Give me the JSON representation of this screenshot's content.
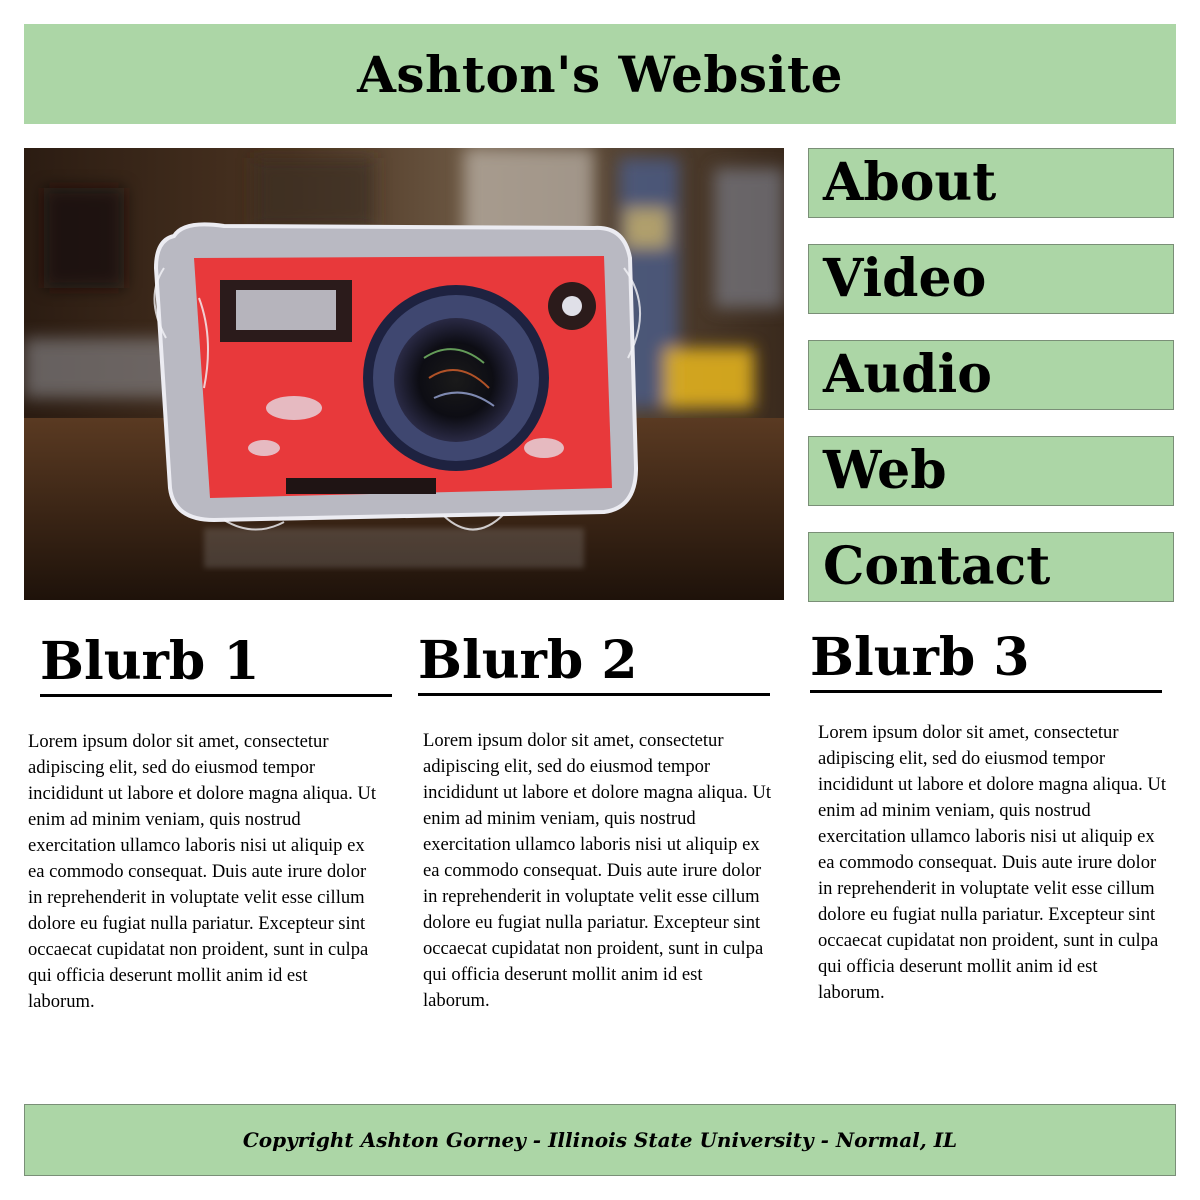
{
  "header": {
    "title": "Ashton's Website"
  },
  "hero": {
    "image_subject": "handmade-red-camera-sculpture"
  },
  "nav": {
    "items": [
      {
        "label": "About"
      },
      {
        "label": "Video"
      },
      {
        "label": "Audio"
      },
      {
        "label": "Web"
      },
      {
        "label": "Contact"
      }
    ]
  },
  "blurbs": [
    {
      "heading": "Blurb 1",
      "text": "Lorem ipsum dolor sit amet, consectetur adipiscing elit, sed do eiusmod tempor incididunt ut labore et dolore magna aliqua. Ut enim ad minim veniam, quis nostrud exercitation ullamco laboris nisi ut aliquip ex ea commodo consequat. Duis aute irure dolor in reprehenderit in voluptate velit esse cillum dolore eu fugiat nulla pariatur. Excepteur sint occaecat cupidatat non proident, sunt in culpa qui officia deserunt mollit anim id est laborum."
    },
    {
      "heading": "Blurb 2",
      "text": "Lorem ipsum dolor sit amet, consectetur adipiscing elit, sed do eiusmod tempor incididunt ut labore et dolore magna aliqua. Ut enim ad minim veniam, quis nostrud exercitation ullamco laboris nisi ut aliquip ex ea commodo consequat. Duis aute irure dolor in reprehenderit in voluptate velit esse cillum dolore eu fugiat nulla pariatur. Excepteur sint occaecat cupidatat non proident, sunt in culpa qui officia deserunt mollit anim id est laborum."
    },
    {
      "heading": "Blurb 3",
      "text": "Lorem ipsum dolor sit amet, consectetur adipiscing elit, sed do eiusmod tempor incididunt ut labore et dolore magna aliqua. Ut enim ad minim veniam, quis nostrud exercitation ullamco laboris nisi ut aliquip ex ea commodo consequat. Duis aute irure dolor in reprehenderit in voluptate velit esse cillum dolore eu fugiat nulla pariatur. Excepteur sint occaecat cupidatat non proident, sunt in culpa qui officia deserunt mollit anim id est laborum."
    }
  ],
  "footer": {
    "text": "Copyright Ashton Gorney - Illinois State University - Normal, IL"
  },
  "colors": {
    "accent_green": "#acd6a6",
    "border": "#7a8f77",
    "text": "#000000",
    "background": "#ffffff"
  }
}
